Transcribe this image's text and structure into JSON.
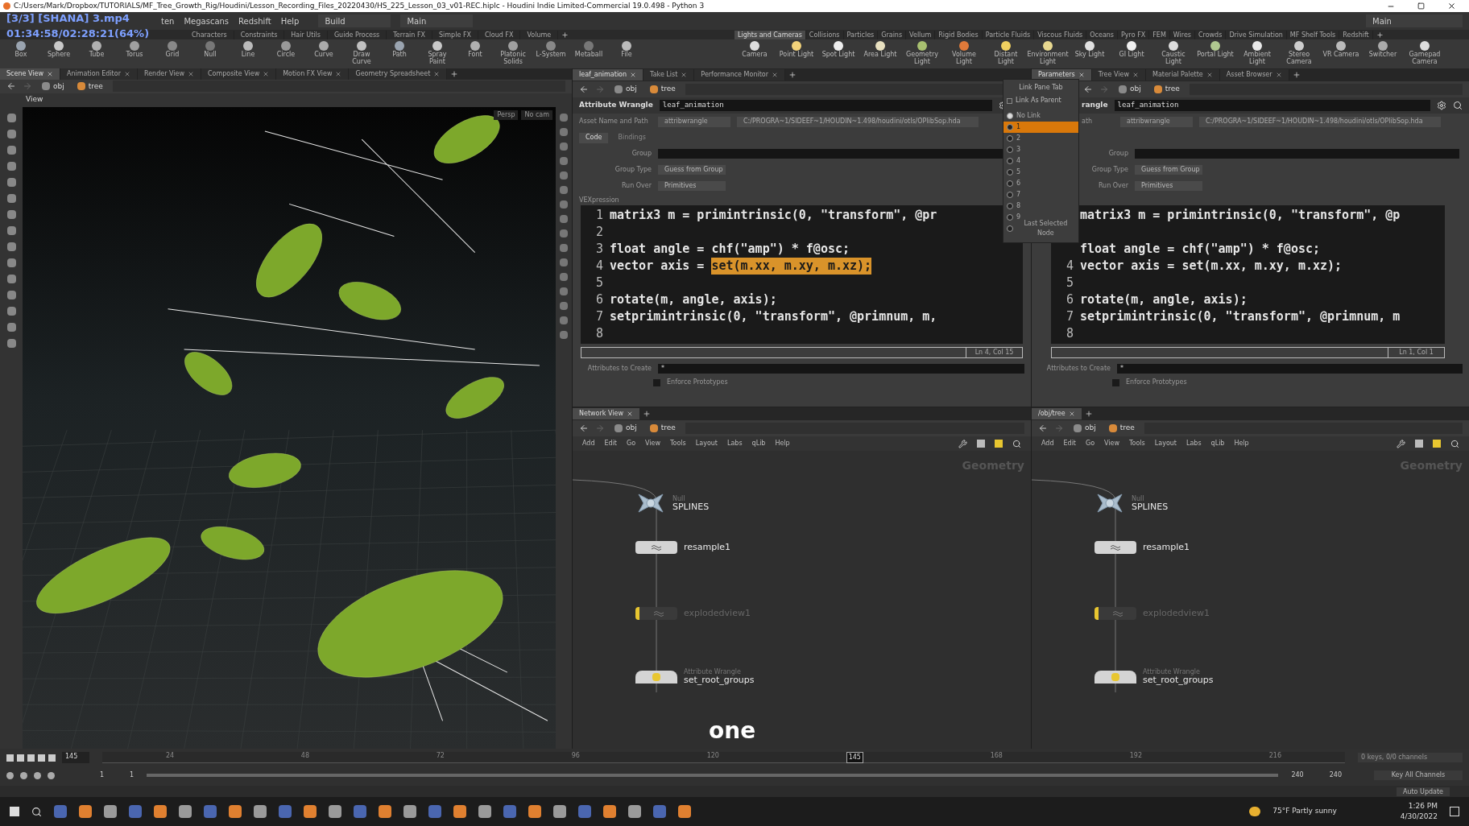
{
  "title_bar": {
    "title": "C:/Users/Mark/Dropbox/TUTORIALS/MF_Tree_Growth_Rig/Houdini/Lesson_Recording_Files_20220430/HS_225_Lesson_03_v01-REC.hiplc - Houdini Indie Limited-Commercial 19.0.498 - Python 3"
  },
  "player_overlay": {
    "file": "[3/3] [SHANA] 3.mp4",
    "time": "01:34:58/02:28:21(64%)"
  },
  "menu": {
    "items": [
      "ten",
      "Megascans",
      "Redshift",
      "Help"
    ],
    "desktop": "Build",
    "context": "Main",
    "right_desktop": "Main"
  },
  "shelf_tabs_left": [
    "Characters",
    "Constraints",
    "Hair Utils",
    "Guide Process",
    "Terrain FX",
    "Simple FX",
    "Cloud FX",
    "Volume"
  ],
  "shelf_tabs_right": [
    {
      "label": "Lights and Cameras",
      "selected": true
    },
    {
      "label": "Collisions",
      "selected": false
    },
    {
      "label": "Particles",
      "selected": false
    },
    {
      "label": "Grains",
      "selected": false
    },
    {
      "label": "Vellum",
      "selected": false
    },
    {
      "label": "Rigid Bodies",
      "selected": false
    },
    {
      "label": "Particle Fluids",
      "selected": false
    },
    {
      "label": "Viscous Fluids",
      "selected": false
    },
    {
      "label": "Oceans",
      "selected": false
    },
    {
      "label": "Pyro FX",
      "selected": false
    },
    {
      "label": "FEM",
      "selected": false
    },
    {
      "label": "Wires",
      "selected": false
    },
    {
      "label": "Crowds",
      "selected": false
    },
    {
      "label": "Drive Simulation",
      "selected": false
    },
    {
      "label": "MF Shelf Tools",
      "selected": false
    },
    {
      "label": "Redshift",
      "selected": false
    }
  ],
  "shelf_tools_left": [
    "Box",
    "Sphere",
    "Tube",
    "Torus",
    "Grid",
    "Null",
    "Line",
    "Circle",
    "Curve",
    "Draw Curve",
    "Path",
    "Spray Paint",
    "Font",
    "Platonic Solids",
    "L-System",
    "Metaball",
    "File"
  ],
  "shelf_tools_right": [
    "Camera",
    "Point Light",
    "Spot Light",
    "Area Light",
    "Geometry Light",
    "Volume Light",
    "Distant Light",
    "Environment Light",
    "Sky Light",
    "GI Light",
    "Caustic Light",
    "Portal Light",
    "Ambient Light",
    "Stereo Camera",
    "VR Camera",
    "Switcher",
    "Gamepad Camera"
  ],
  "scene_pane": {
    "tabs": [
      {
        "label": "Scene View",
        "selected": true
      },
      {
        "label": "Animation Editor",
        "selected": false
      },
      {
        "label": "Render View",
        "selected": false
      },
      {
        "label": "Composite View",
        "selected": false
      },
      {
        "label": "Motion FX View",
        "selected": false
      },
      {
        "label": "Geometry Spreadsheet",
        "selected": false
      }
    ],
    "path": [
      "obj",
      "tree"
    ],
    "view_label": "View",
    "camera": "Persp",
    "cam_menu": "No cam"
  },
  "param_panes": [
    {
      "tabs": [
        {
          "label": "leaf_animation",
          "selected": true
        },
        {
          "label": "Take List",
          "selected": false
        },
        {
          "label": "Performance Monitor",
          "selected": false
        }
      ],
      "path": [
        "obj",
        "tree"
      ],
      "node_type": "Attribute Wrangle",
      "node_name": "leaf_animation",
      "asset_label": "Asset Name and Path",
      "asset_name": "attribwrangle",
      "asset_path": "C:/PROGRA~1/SIDEEF~1/HOUDIN~1.498/houdini/otls/OPlibSop.hda",
      "code_tabs": [
        {
          "label": "Code",
          "selected": true
        },
        {
          "label": "Bindings",
          "selected": false
        }
      ],
      "group_label": "Group",
      "group_type_label": "Group Type",
      "group_type": "Guess from Group",
      "run_over_label": "Run Over",
      "run_over": "Primitives",
      "vex_label": "VEXpression",
      "code": [
        {
          "number": "1",
          "text": "matrix3 m = primintrinsic(0, \"transform\", @pr"
        },
        {
          "number": "2"
        },
        {
          "number": "3",
          "text": "float angle = chf(\"amp\") * f@osc;"
        },
        {
          "number": "4",
          "text": "vector axis = ",
          "selected_text": "set(m.xx, m.xy, m.xz);"
        },
        {
          "number": "5"
        },
        {
          "number": "6",
          "text": "rotate(m, angle, axis);"
        },
        {
          "number": "7",
          "text": "setprimintrinsic(0, \"transform\", @primnum, m,"
        },
        {
          "number": "8"
        }
      ],
      "cursor": "Ln 4, Col 15",
      "attrs_label": "Attributes to Create",
      "attrs": "*",
      "enforce_label": "Enforce Prototypes",
      "enforce": false
    },
    {
      "tabs": [
        {
          "label": "Parameters",
          "selected": true
        },
        {
          "label": "Tree View",
          "selected": false
        },
        {
          "label": "Material Palette",
          "selected": false
        },
        {
          "label": "Asset Browser",
          "selected": false
        }
      ],
      "path": [
        "obj",
        "tree"
      ],
      "node_type": "rangle",
      "node_name": "leaf_animation",
      "asset_label": "ath",
      "asset_name": "attribwrangle",
      "asset_path": "C:/PROGRA~1/SIDEEF~1/HOUDIN~1.498/houdini/otls/OPlibSop.hda",
      "group_label": "Group",
      "group_type_label": "Group Type",
      "group_type": "Guess from Group",
      "run_over_label": "Run Over",
      "run_over": "Primitives",
      "code": [
        {
          "text": "matrix3 m = primintrinsic(0, \"transform\", @p"
        },
        {
          "kind": "after_blank_line",
          "text": "float angle = chf(\"amp\") * f@osc;"
        },
        {
          "number": "4",
          "text": "vector axis = set(m.xx, m.xy, m.xz);"
        },
        {
          "number": "5"
        },
        {
          "number": "6",
          "text": "rotate(m, angle, axis);"
        },
        {
          "number": "7",
          "text": "setprimintrinsic(0, \"transform\", @primnum, m"
        },
        {
          "number": "8"
        }
      ],
      "cursor": "Ln 1, Col 1",
      "attrs_label": "Attributes to Create",
      "attrs": "*",
      "enforce_label": "Enforce Prototypes",
      "enforce": false
    }
  ],
  "link_menu": {
    "title": "Link Pane Tab",
    "link_as_parent": {
      "label": "Link As Parent",
      "checked": false
    },
    "items": [
      {
        "label": "No Link",
        "selected": true,
        "highlighted": false
      },
      {
        "label": "1",
        "selected": false,
        "highlighted": true
      },
      {
        "label": "2",
        "selected": false,
        "highlighted": false
      },
      {
        "label": "3",
        "selected": false,
        "highlighted": false
      },
      {
        "label": "4",
        "selected": false,
        "highlighted": false
      },
      {
        "label": "5",
        "selected": false,
        "highlighted": false
      },
      {
        "label": "6",
        "selected": false,
        "highlighted": false
      },
      {
        "label": "7",
        "selected": false,
        "highlighted": false
      },
      {
        "label": "8",
        "selected": false,
        "highlighted": false
      },
      {
        "label": "9",
        "selected": false,
        "highlighted": false
      },
      {
        "label": "Last Selected Node",
        "selected": false,
        "highlighted": false
      }
    ]
  },
  "network_panes": [
    {
      "tab": "Network View",
      "path": [
        "obj",
        "tree"
      ],
      "menu": [
        "Add",
        "Edit",
        "Go",
        "View",
        "Tools",
        "Layout",
        "Labs",
        "qLib",
        "Help"
      ],
      "context": "Geometry",
      "nodes": [
        {
          "kind": "null",
          "type": "Null",
          "name": "SPLINES",
          "bypassed": false
        },
        {
          "kind": "sop",
          "name": "resample1",
          "bypassed": false
        },
        {
          "kind": "sop",
          "name": "explodedview1",
          "bypassed": true
        },
        {
          "kind": "wrangle",
          "type": "Attribute Wrangle",
          "name": "set_root_groups",
          "bypassed": false
        }
      ]
    },
    {
      "tab": "/obj/tree",
      "path": [
        "obj",
        "tree"
      ],
      "menu": [
        "Add",
        "Edit",
        "Go",
        "View",
        "Tools",
        "Layout",
        "Labs",
        "qLib",
        "Help"
      ],
      "context": "Geometry",
      "nodes": [
        {
          "kind": "null",
          "type": "Null",
          "name": "SPLINES",
          "bypassed": false
        },
        {
          "kind": "sop",
          "name": "resample1",
          "bypassed": false
        },
        {
          "kind": "sop",
          "name": "explodedview1",
          "bypassed": true
        },
        {
          "kind": "wrangle",
          "type": "Attribute Wrangle",
          "name": "set_root_groups",
          "bypassed": false
        }
      ]
    }
  ],
  "timeline": {
    "frame": "145",
    "ticks": [
      {
        "label": "24",
        "current": false
      },
      {
        "label": "48",
        "current": false
      },
      {
        "label": "72",
        "current": false
      },
      {
        "label": "96",
        "current": false
      },
      {
        "label": "120",
        "current": false
      },
      {
        "label": "145",
        "current": true
      },
      {
        "label": "168",
        "current": false
      },
      {
        "label": "192",
        "current": false
      },
      {
        "label": "216",
        "current": false
      }
    ],
    "range_slider": {
      "level": 1
    },
    "keys": "0 keys, 0/0 channels",
    "start": "1",
    "range_start": "1",
    "range_end": "240",
    "end": "240",
    "key_all": "Key All Channels",
    "auto_update": "Auto Update"
  },
  "subtitle": "one",
  "taskbar": {
    "weather": "75°F Partly sunny",
    "time": "1:26 PM",
    "date": "4/30/2022"
  }
}
